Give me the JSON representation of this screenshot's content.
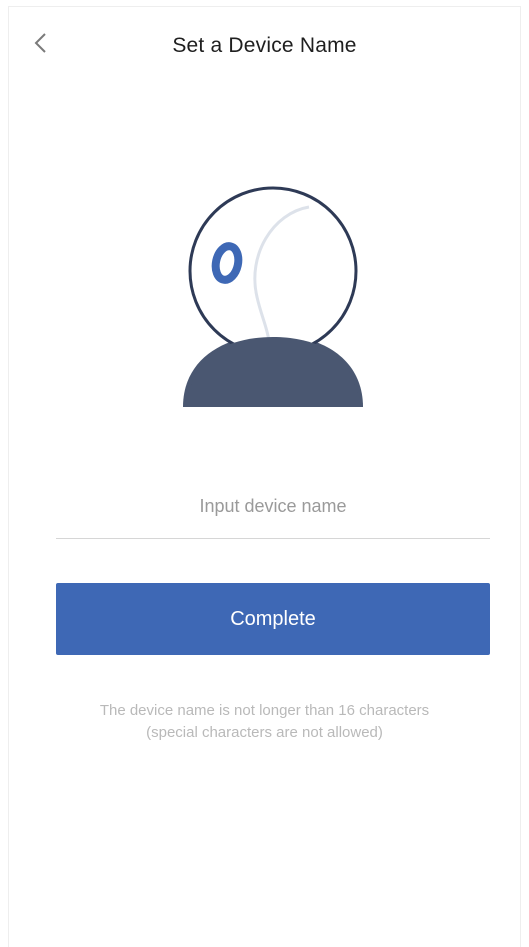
{
  "header": {
    "title": "Set a Device Name",
    "back_icon": "chevron-left-icon"
  },
  "illustration": {
    "icon": "dome-camera-icon",
    "colors": {
      "outline": "#2e3a56",
      "base": "#4a5771",
      "lens": "#3e68b5",
      "highlight": "#dde2ea"
    }
  },
  "form": {
    "name_value": "",
    "name_placeholder": "Input device name",
    "submit_label": "Complete",
    "accent": "#3e68b5"
  },
  "hint": {
    "line1": "The device name is not longer than 16 characters",
    "line2": "(special characters are not allowed)"
  }
}
